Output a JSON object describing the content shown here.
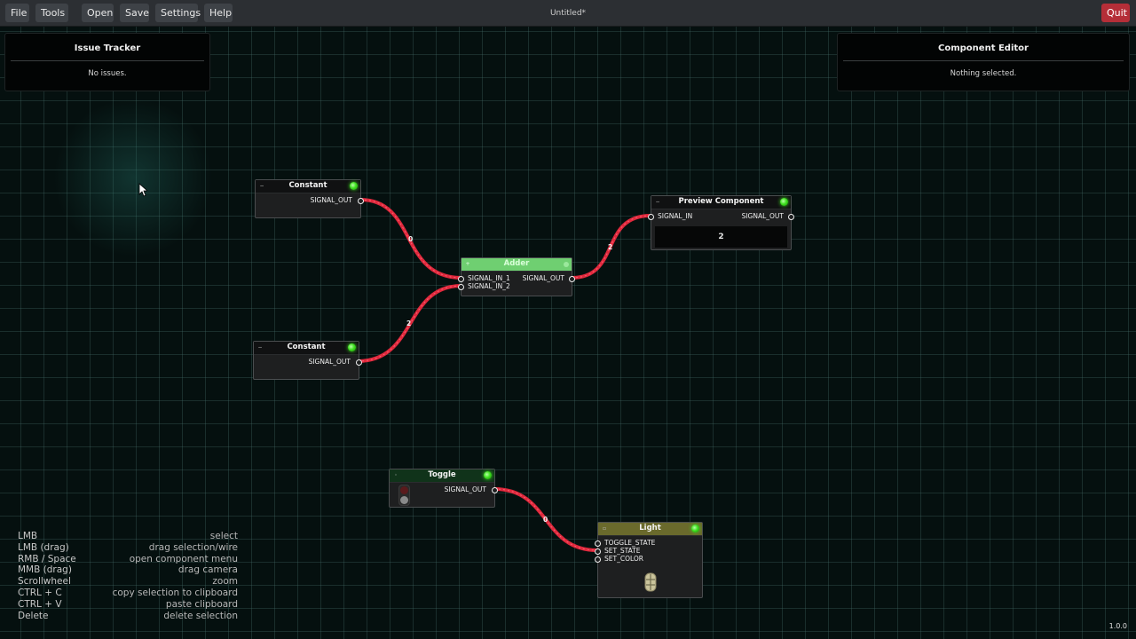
{
  "menu": {
    "file": "File",
    "tools": "Tools",
    "open": "Open",
    "save": "Save",
    "settings": "Settings",
    "help": "Help",
    "quit": "Quit"
  },
  "document_title": "Untitled*",
  "issue_tracker": {
    "title": "Issue Tracker",
    "message": "No issues."
  },
  "component_editor": {
    "title": "Component Editor",
    "message": "Nothing selected."
  },
  "nodes": {
    "constant1": {
      "title": "Constant",
      "output": "SIGNAL_OUT"
    },
    "constant2": {
      "title": "Constant",
      "output": "SIGNAL_OUT"
    },
    "adder": {
      "title": "Adder",
      "input1": "SIGNAL_IN_1",
      "input2": "SIGNAL_IN_2",
      "output": "SIGNAL_OUT"
    },
    "preview": {
      "title": "Preview Component",
      "input": "SIGNAL_IN",
      "output": "SIGNAL_OUT",
      "value": "2"
    },
    "toggle": {
      "title": "Toggle",
      "output": "SIGNAL_OUT"
    },
    "light": {
      "title": "Light",
      "input1": "TOGGLE_STATE",
      "input2": "SET_STATE",
      "input3": "SET_COLOR"
    }
  },
  "wire_values": {
    "constant1_to_adder": "0",
    "constant2_to_adder": "2",
    "adder_to_preview": "2",
    "toggle_to_light": "0"
  },
  "shortcuts": [
    {
      "key": "LMB",
      "action": "select"
    },
    {
      "key": "LMB (drag)",
      "action": "drag selection/wire"
    },
    {
      "key": "RMB / Space",
      "action": "open component menu"
    },
    {
      "key": "MMB (drag)",
      "action": "drag camera"
    },
    {
      "key": "Scrollwheel",
      "action": "zoom"
    },
    {
      "key": "CTRL + C",
      "action": "copy selection to clipboard"
    },
    {
      "key": "CTRL + V",
      "action": "paste clipboard"
    },
    {
      "key": "Delete",
      "action": "delete selection"
    }
  ],
  "zoom": "1.0.0",
  "colors": {
    "wire": "#e0283c",
    "adder_header": "#6fcf71",
    "light_header": "#6a6a2c",
    "toggle_header": "#10331a",
    "led": "#3fe01f",
    "quit": "#b52e38"
  }
}
